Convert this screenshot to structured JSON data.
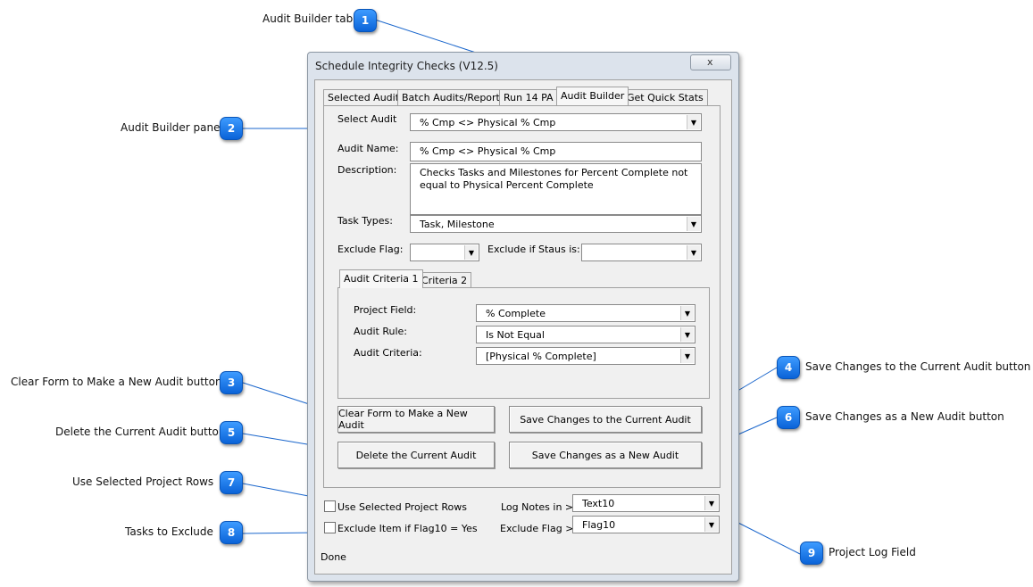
{
  "callouts": [
    {
      "num": "1",
      "label": "Audit Builder tab"
    },
    {
      "num": "2",
      "label": "Audit Builder pane"
    },
    {
      "num": "3",
      "label": "Clear Form to Make a New Audit button"
    },
    {
      "num": "4",
      "label": "Save Changes to the Current Audit button"
    },
    {
      "num": "5",
      "label": "Delete the Current Audit button"
    },
    {
      "num": "6",
      "label": "Save Changes as a New Audit button"
    },
    {
      "num": "7",
      "label": "Use Selected Project Rows"
    },
    {
      "num": "8",
      "label": "Tasks to Exclude"
    },
    {
      "num": "9",
      "label": "Project Log Field"
    }
  ],
  "dialog": {
    "title": "Schedule Integrity Checks (V12.5)",
    "close": "x",
    "tabs": [
      "Selected Audit",
      "Batch Audits/Reports",
      "Run 14 PA",
      "Audit Builder",
      "Get Quick Stats"
    ],
    "active_tab": "Audit Builder",
    "builder": {
      "select_audit_label": "Select Audit",
      "select_audit_value": "% Cmp <> Physical % Cmp",
      "audit_name_label": "Audit Name:",
      "audit_name_value": "% Cmp <> Physical % Cmp",
      "description_label": "Description:",
      "description_value": "Checks Tasks and Milestones for Percent Complete not equal to Physical Percent Complete",
      "task_types_label": "Task Types:",
      "task_types_value": "Task, Milestone",
      "exclude_flag_label": "Exclude Flag:",
      "exclude_flag_value": "",
      "exclude_status_label": "Exclude if Staus is:",
      "exclude_status_value": "",
      "criteria_tabs": [
        "Audit Criteria 1",
        "Criteria 2"
      ],
      "project_field_label": "Project Field:",
      "project_field_value": "% Complete",
      "audit_rule_label": "Audit Rule:",
      "audit_rule_value": "Is Not Equal",
      "audit_criteria_label": "Audit Criteria:",
      "audit_criteria_value": "[Physical % Complete]",
      "btn_clear": "Clear Form to Make a New Audit",
      "btn_save_current": "Save Changes to the Current Audit",
      "btn_delete": "Delete the Current Audit",
      "btn_save_new": "Save Changes as a New Audit"
    },
    "footer": {
      "use_selected_label": "Use Selected Project Rows",
      "exclude_item_label": "Exclude Item if Flag10 = Yes",
      "log_notes_label": "Log Notes in >",
      "log_notes_value": "Text10",
      "exclude_flag_label": "Exclude Flag >",
      "exclude_flag_value": "Flag10",
      "status": "Done"
    }
  }
}
